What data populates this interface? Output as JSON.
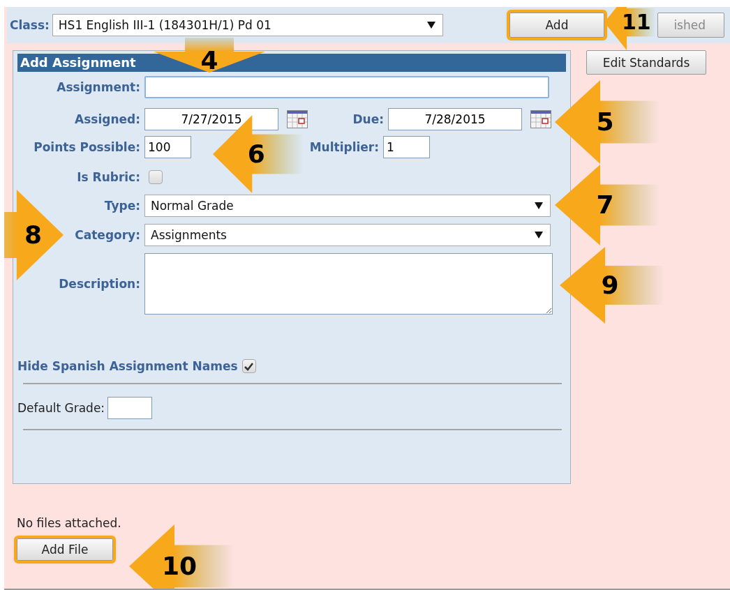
{
  "class_selector": {
    "label": "Class:",
    "value": "HS1 English III-1 (184301H/1) Pd 01"
  },
  "top_buttons": [
    {
      "label": "Add",
      "highlighted": true
    },
    {
      "label": "ished",
      "highlighted": false
    }
  ],
  "edit_standards_button": "Edit Standards",
  "form": {
    "title": "Add Assignment",
    "rows": [
      {
        "kind": "text",
        "label": "Assignment:"
      },
      {
        "kind": "pair",
        "fields": [
          {
            "kind": "date",
            "label": "Assigned:",
            "value": "7/27/2015"
          },
          {
            "kind": "date",
            "label": "Due:",
            "value": "7/28/2015"
          }
        ]
      },
      {
        "kind": "pair",
        "fields": [
          {
            "kind": "number",
            "label": "Points Possible:",
            "value": "100"
          },
          {
            "kind": "number",
            "label": "Multiplier:",
            "value": "1"
          }
        ]
      },
      {
        "kind": "checkbox",
        "label": "Is Rubric:",
        "checked": false
      },
      {
        "kind": "select",
        "label": "Type:",
        "value": "Normal Grade"
      },
      {
        "kind": "select",
        "label": "Category:",
        "value": "Assignments"
      },
      {
        "kind": "textarea",
        "label": "Description:"
      }
    ],
    "hide_spanish": {
      "label": "Hide Spanish Assignment Names",
      "checked": true
    },
    "default_grade": {
      "label": "Default Grade:"
    }
  },
  "attachments": {
    "message": "No files attached.",
    "button": {
      "label": "Add File",
      "highlighted": true
    }
  },
  "callouts": [
    {
      "number": "4",
      "kind": "down"
    },
    {
      "number": "5",
      "kind": "left"
    },
    {
      "number": "6",
      "kind": "left"
    },
    {
      "number": "7",
      "kind": "left"
    },
    {
      "number": "8",
      "kind": "right"
    },
    {
      "number": "9",
      "kind": "left"
    },
    {
      "number": "10",
      "kind": "left"
    },
    {
      "number": "11",
      "kind": "left"
    }
  ]
}
